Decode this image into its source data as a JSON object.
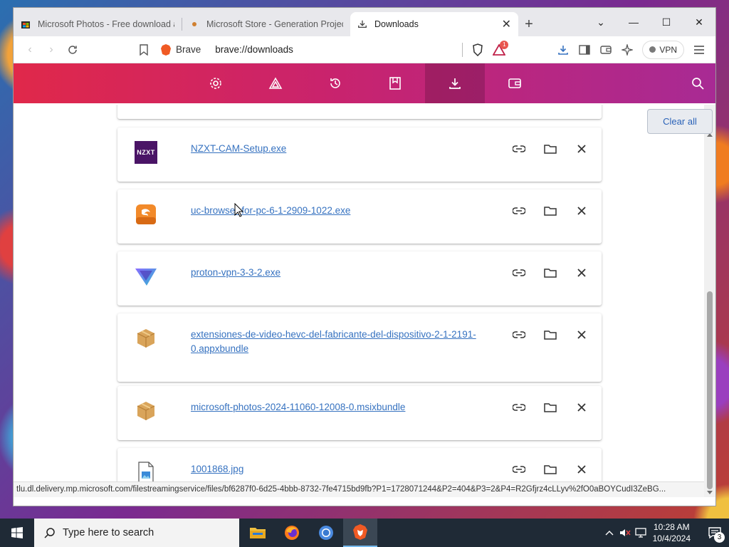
{
  "tabs": [
    {
      "title": "Microsoft Photos - Free download a",
      "active": false
    },
    {
      "title": "Microsoft Store - Generation Projec",
      "active": false
    },
    {
      "title": "Downloads",
      "active": true
    }
  ],
  "toolbar": {
    "brave_label": "Brave",
    "url": "brave://downloads",
    "vpn_label": "VPN",
    "rewards_badge": "1"
  },
  "brave_nav": {
    "items": [
      "settings-icon",
      "rewards-icon",
      "history-icon",
      "bookmarks-icon",
      "downloads-icon",
      "wallet-icon"
    ],
    "active": "downloads-icon"
  },
  "downloads": {
    "clear_all_label": "Clear all",
    "items": [
      {
        "filename": "NZXT-CAM-Setup.exe",
        "icon": "nzxt-logo",
        "icon_text": "NZXT"
      },
      {
        "filename": "uc-browser-for-pc-6-1-2909-1022.exe",
        "icon": "uc-browser-icon"
      },
      {
        "filename": "proton-vpn-3-3-2.exe",
        "icon": "proton-vpn-icon"
      },
      {
        "filename": "extensiones-de-video-hevc-del-fabricante-del-dispositivo-2-1-2191-0.appxbundle",
        "icon": "package-icon"
      },
      {
        "filename": "microsoft-photos-2024-11060-12008-0.msixbundle",
        "icon": "package-icon"
      },
      {
        "filename": "1001868.jpg",
        "icon": "image-file-icon"
      }
    ]
  },
  "status_url": "tlu.dl.delivery.mp.microsoft.com/filestreamingservice/files/bf6287f0-6d25-4bbb-8732-7fe4715bd9fb?P1=1728071244&P2=404&P3=2&P4=R2Gfjrz4cLLyv%2fO0aBOYCudI3ZeBG...",
  "taskbar": {
    "search_placeholder": "Type here to search",
    "time": "10:28 AM",
    "date": "10/4/2024",
    "notification_count": "3"
  },
  "colors": {
    "brave_gradient_start": "#e0284a",
    "brave_gradient_end": "#a82a94",
    "link": "#3672c0"
  }
}
